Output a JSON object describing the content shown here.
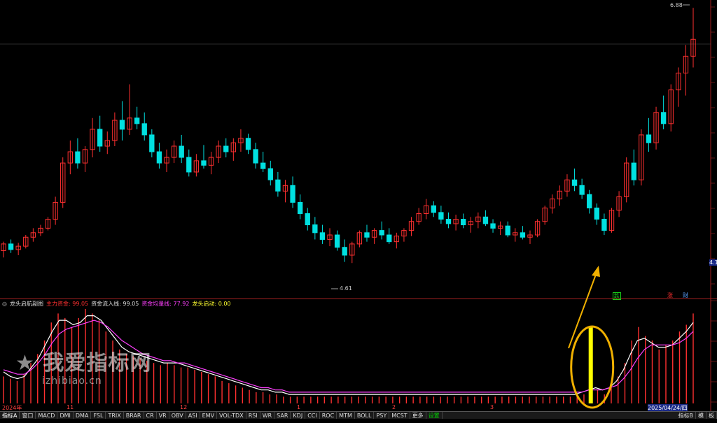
{
  "top_title": "",
  "price_chart": {
    "type": "candlestick",
    "high_label": "6.88",
    "low_label": "4.61",
    "right_edge_label": "4.1",
    "y_range": [
      4.4,
      6.9
    ],
    "tags": [
      {
        "text": "跌",
        "color": "#19d219"
      },
      {
        "text": "涨",
        "color": "#ff3030"
      },
      {
        "text": "财",
        "color": "#5aa0ff"
      }
    ]
  },
  "indicator": {
    "name": "龙头启航副图",
    "fields": [
      {
        "label": "主力资金:",
        "value": "99.05",
        "color": "#ff3030"
      },
      {
        "label": "资金流入线:",
        "value": "99.05",
        "color": "#dddddd"
      },
      {
        "label": "资金均量线:",
        "value": "77.92",
        "color": "#ff40ff"
      },
      {
        "label": "龙头启动:",
        "value": "0.00",
        "color": "#ffff30"
      }
    ]
  },
  "date_labels": [
    "2024年",
    "11",
    "12",
    "1",
    "2",
    "3"
  ],
  "selected_date": "2025/04/24/四",
  "tabs": [
    "指标A",
    "窗口",
    "MACD",
    "DMI",
    "DMA",
    "FSL",
    "TRIX",
    "BRAR",
    "CR",
    "VR",
    "OBV",
    "ASI",
    "EMV",
    "VOL-TDX",
    "RSI",
    "WR",
    "SAR",
    "KDJ",
    "CCI",
    "ROC",
    "MTM",
    "BOLL",
    "PSY",
    "MCST",
    "更多",
    "设置"
  ],
  "right_tabs": [
    "指标B",
    "模",
    "板"
  ],
  "watermark": {
    "line1": "我爱指标网",
    "line2": "izhibiao.cn"
  },
  "colors": {
    "up": "#ff3030",
    "down": "#00e0e0",
    "accent_yellow": "#ffff00",
    "ellipse": "#f0b000",
    "arrow": "#f0b000"
  },
  "chart_data": {
    "type": "candlestick",
    "ylim": [
      4.4,
      6.9
    ],
    "ohlc": [
      [
        4.72,
        4.8,
        4.66,
        4.78
      ],
      [
        4.78,
        4.82,
        4.7,
        4.73
      ],
      [
        4.73,
        4.79,
        4.68,
        4.76
      ],
      [
        4.76,
        4.86,
        4.74,
        4.84
      ],
      [
        4.84,
        4.92,
        4.8,
        4.88
      ],
      [
        4.88,
        4.95,
        4.85,
        4.92
      ],
      [
        4.92,
        5.02,
        4.9,
        5.0
      ],
      [
        5.0,
        5.2,
        4.95,
        5.15
      ],
      [
        5.15,
        5.55,
        5.1,
        5.5
      ],
      [
        5.5,
        5.7,
        5.4,
        5.6
      ],
      [
        5.6,
        5.72,
        5.45,
        5.5
      ],
      [
        5.5,
        5.65,
        5.42,
        5.62
      ],
      [
        5.62,
        5.9,
        5.55,
        5.8
      ],
      [
        5.8,
        5.92,
        5.6,
        5.65
      ],
      [
        5.65,
        5.78,
        5.58,
        5.7
      ],
      [
        5.7,
        5.95,
        5.65,
        5.88
      ],
      [
        5.88,
        6.05,
        5.7,
        5.8
      ],
      [
        5.8,
        6.2,
        5.75,
        5.9
      ],
      [
        5.9,
        6.0,
        5.8,
        5.85
      ],
      [
        5.85,
        5.95,
        5.7,
        5.75
      ],
      [
        5.75,
        5.8,
        5.55,
        5.6
      ],
      [
        5.6,
        5.68,
        5.45,
        5.5
      ],
      [
        5.5,
        5.62,
        5.42,
        5.55
      ],
      [
        5.55,
        5.7,
        5.5,
        5.65
      ],
      [
        5.65,
        5.75,
        5.5,
        5.55
      ],
      [
        5.55,
        5.62,
        5.38,
        5.42
      ],
      [
        5.42,
        5.58,
        5.38,
        5.52
      ],
      [
        5.52,
        5.66,
        5.45,
        5.48
      ],
      [
        5.48,
        5.6,
        5.4,
        5.55
      ],
      [
        5.55,
        5.7,
        5.5,
        5.65
      ],
      [
        5.65,
        5.72,
        5.55,
        5.6
      ],
      [
        5.6,
        5.72,
        5.52,
        5.68
      ],
      [
        5.68,
        5.8,
        5.6,
        5.72
      ],
      [
        5.72,
        5.76,
        5.58,
        5.62
      ],
      [
        5.62,
        5.68,
        5.45,
        5.5
      ],
      [
        5.5,
        5.6,
        5.42,
        5.45
      ],
      [
        5.45,
        5.52,
        5.3,
        5.35
      ],
      [
        5.35,
        5.42,
        5.2,
        5.25
      ],
      [
        5.25,
        5.35,
        5.15,
        5.3
      ],
      [
        5.3,
        5.38,
        5.1,
        5.15
      ],
      [
        5.15,
        5.22,
        5.0,
        5.05
      ],
      [
        5.05,
        5.1,
        4.9,
        4.95
      ],
      [
        4.95,
        5.02,
        4.82,
        4.88
      ],
      [
        4.88,
        4.95,
        4.78,
        4.82
      ],
      [
        4.82,
        4.92,
        4.76,
        4.86
      ],
      [
        4.86,
        4.9,
        4.72,
        4.75
      ],
      [
        4.75,
        4.82,
        4.62,
        4.68
      ],
      [
        4.68,
        4.8,
        4.61,
        4.78
      ],
      [
        4.78,
        4.9,
        4.75,
        4.88
      ],
      [
        4.88,
        4.95,
        4.8,
        4.84
      ],
      [
        4.84,
        4.92,
        4.78,
        4.9
      ],
      [
        4.9,
        4.98,
        4.82,
        4.86
      ],
      [
        4.86,
        4.92,
        4.78,
        4.8
      ],
      [
        4.8,
        4.88,
        4.74,
        4.85
      ],
      [
        4.85,
        4.92,
        4.8,
        4.9
      ],
      [
        4.9,
        5.02,
        4.85,
        4.98
      ],
      [
        4.98,
        5.1,
        4.95,
        5.05
      ],
      [
        5.05,
        5.18,
        5.0,
        5.12
      ],
      [
        5.12,
        5.16,
        5.02,
        5.06
      ],
      [
        5.06,
        5.12,
        4.96,
        5.0
      ],
      [
        5.0,
        5.06,
        4.92,
        4.96
      ],
      [
        4.96,
        5.04,
        4.9,
        5.0
      ],
      [
        5.0,
        5.05,
        4.92,
        4.95
      ],
      [
        4.95,
        5.02,
        4.88,
        4.98
      ],
      [
        4.98,
        5.06,
        4.92,
        5.02
      ],
      [
        5.02,
        5.08,
        4.94,
        4.96
      ],
      [
        4.96,
        5.0,
        4.88,
        4.92
      ],
      [
        4.92,
        4.98,
        4.86,
        4.94
      ],
      [
        4.94,
        4.98,
        4.84,
        4.86
      ],
      [
        4.86,
        4.92,
        4.8,
        4.88
      ],
      [
        4.88,
        4.94,
        4.82,
        4.84
      ],
      [
        4.84,
        4.9,
        4.78,
        4.86
      ],
      [
        4.86,
        5.0,
        4.84,
        4.98
      ],
      [
        4.98,
        5.12,
        4.95,
        5.1
      ],
      [
        5.1,
        5.22,
        5.05,
        5.18
      ],
      [
        5.18,
        5.3,
        5.12,
        5.25
      ],
      [
        5.25,
        5.4,
        5.2,
        5.35
      ],
      [
        5.35,
        5.45,
        5.25,
        5.3
      ],
      [
        5.3,
        5.36,
        5.18,
        5.22
      ],
      [
        5.22,
        5.26,
        5.05,
        5.1
      ],
      [
        5.1,
        5.14,
        4.95,
        5.0
      ],
      [
        5.0,
        5.05,
        4.86,
        4.9
      ],
      [
        4.9,
        5.1,
        4.88,
        5.08
      ],
      [
        5.08,
        5.25,
        5.02,
        5.2
      ],
      [
        5.2,
        5.55,
        5.15,
        5.5
      ],
      [
        5.5,
        5.62,
        5.3,
        5.35
      ],
      [
        5.35,
        5.8,
        5.3,
        5.75
      ],
      [
        5.75,
        5.9,
        5.6,
        5.68
      ],
      [
        5.68,
        6.0,
        5.62,
        5.95
      ],
      [
        5.95,
        6.1,
        5.8,
        5.85
      ],
      [
        5.85,
        6.2,
        5.78,
        6.15
      ],
      [
        6.15,
        6.35,
        6.0,
        6.3
      ],
      [
        6.3,
        6.55,
        6.1,
        6.45
      ],
      [
        6.45,
        6.88,
        6.35,
        6.6
      ]
    ],
    "indicator_bars": [
      12,
      11,
      10,
      13,
      18,
      22,
      28,
      36,
      40,
      38,
      34,
      38,
      42,
      40,
      37,
      32,
      28,
      24,
      22,
      21,
      20,
      19,
      18,
      17,
      18,
      17,
      16,
      16,
      15,
      14,
      13,
      12,
      10,
      9,
      8,
      7,
      6,
      5,
      5,
      4,
      4,
      3,
      3,
      3,
      3,
      3,
      3,
      3,
      3,
      3,
      3,
      3,
      3,
      3,
      3,
      3,
      3,
      3,
      3,
      3,
      3,
      3,
      3,
      3,
      3,
      3,
      3,
      3,
      3,
      3,
      3,
      3,
      3,
      3,
      3,
      3,
      3,
      3,
      3,
      3,
      3,
      3,
      3,
      3,
      3,
      4,
      5,
      6,
      4,
      8,
      12,
      18,
      28,
      34,
      30,
      28,
      24,
      26,
      28,
      32,
      35,
      40
    ],
    "inflow_line": [
      14,
      12,
      11,
      12,
      16,
      20,
      26,
      32,
      37,
      37,
      35,
      36,
      39,
      39,
      37,
      33,
      29,
      25,
      23,
      22,
      21,
      20,
      19,
      18,
      18,
      18,
      17,
      16,
      15,
      14,
      13,
      12,
      11,
      10,
      9,
      8,
      7,
      6,
      6,
      5,
      5,
      4,
      4,
      4,
      4,
      4,
      4,
      4,
      4,
      4,
      4,
      4,
      4,
      4,
      4,
      4,
      4,
      4,
      4,
      4,
      4,
      4,
      4,
      4,
      4,
      4,
      4,
      4,
      4,
      4,
      4,
      4,
      4,
      4,
      4,
      4,
      4,
      4,
      4,
      4,
      4,
      4,
      4,
      5,
      6,
      7,
      6,
      7,
      10,
      15,
      22,
      28,
      29,
      27,
      25,
      25,
      26,
      29,
      32,
      36
    ],
    "avg_line": [
      15,
      14,
      13,
      13,
      15,
      18,
      22,
      27,
      31,
      33,
      34,
      35,
      36,
      37,
      36,
      34,
      31,
      28,
      26,
      24,
      22,
      21,
      20,
      19,
      19,
      18,
      18,
      17,
      16,
      15,
      14,
      13,
      12,
      11,
      10,
      9,
      8,
      7,
      7,
      6,
      6,
      5,
      5,
      5,
      5,
      5,
      5,
      5,
      5,
      5,
      5,
      5,
      5,
      5,
      5,
      5,
      5,
      5,
      5,
      5,
      5,
      5,
      5,
      5,
      5,
      5,
      5,
      5,
      5,
      5,
      5,
      5,
      5,
      5,
      5,
      5,
      5,
      5,
      5,
      5,
      5,
      5,
      5,
      5,
      6,
      6,
      6,
      7,
      8,
      11,
      15,
      20,
      24,
      26,
      26,
      26,
      26,
      27,
      29,
      32
    ],
    "signal_index": 86
  }
}
